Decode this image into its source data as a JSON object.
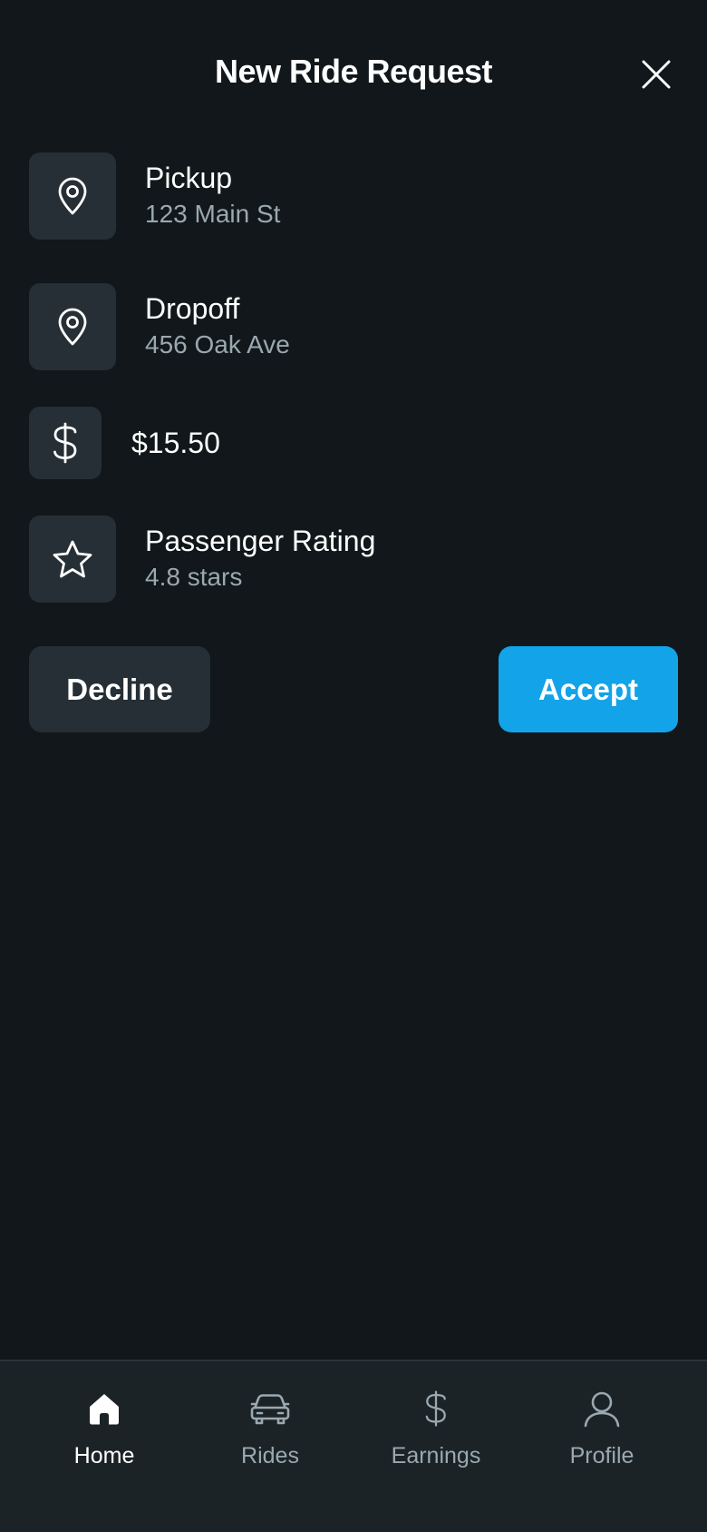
{
  "header": {
    "title": "New Ride Request",
    "close_icon": "close-icon"
  },
  "details": {
    "pickup": {
      "label": "Pickup",
      "value": "123 Main St",
      "icon": "map-pin-icon"
    },
    "dropoff": {
      "label": "Dropoff",
      "value": "456 Oak Ave",
      "icon": "map-pin-icon"
    },
    "fare": {
      "value": "$15.50",
      "icon": "dollar-icon"
    },
    "rating": {
      "label": "Passenger Rating",
      "value": "4.8 stars",
      "icon": "star-icon"
    }
  },
  "actions": {
    "decline_label": "Decline",
    "accept_label": "Accept"
  },
  "tabbar": {
    "items": [
      {
        "label": "Home",
        "icon": "home-icon",
        "active": true
      },
      {
        "label": "Rides",
        "icon": "car-icon",
        "active": false
      },
      {
        "label": "Earnings",
        "icon": "dollar-icon",
        "active": false
      },
      {
        "label": "Profile",
        "icon": "user-icon",
        "active": false
      }
    ]
  },
  "colors": {
    "background": "#11171a",
    "card": "#252f35",
    "accent": "#13a3e9",
    "muted_text": "#9aa8b0",
    "tabbar": "#1c2327"
  }
}
